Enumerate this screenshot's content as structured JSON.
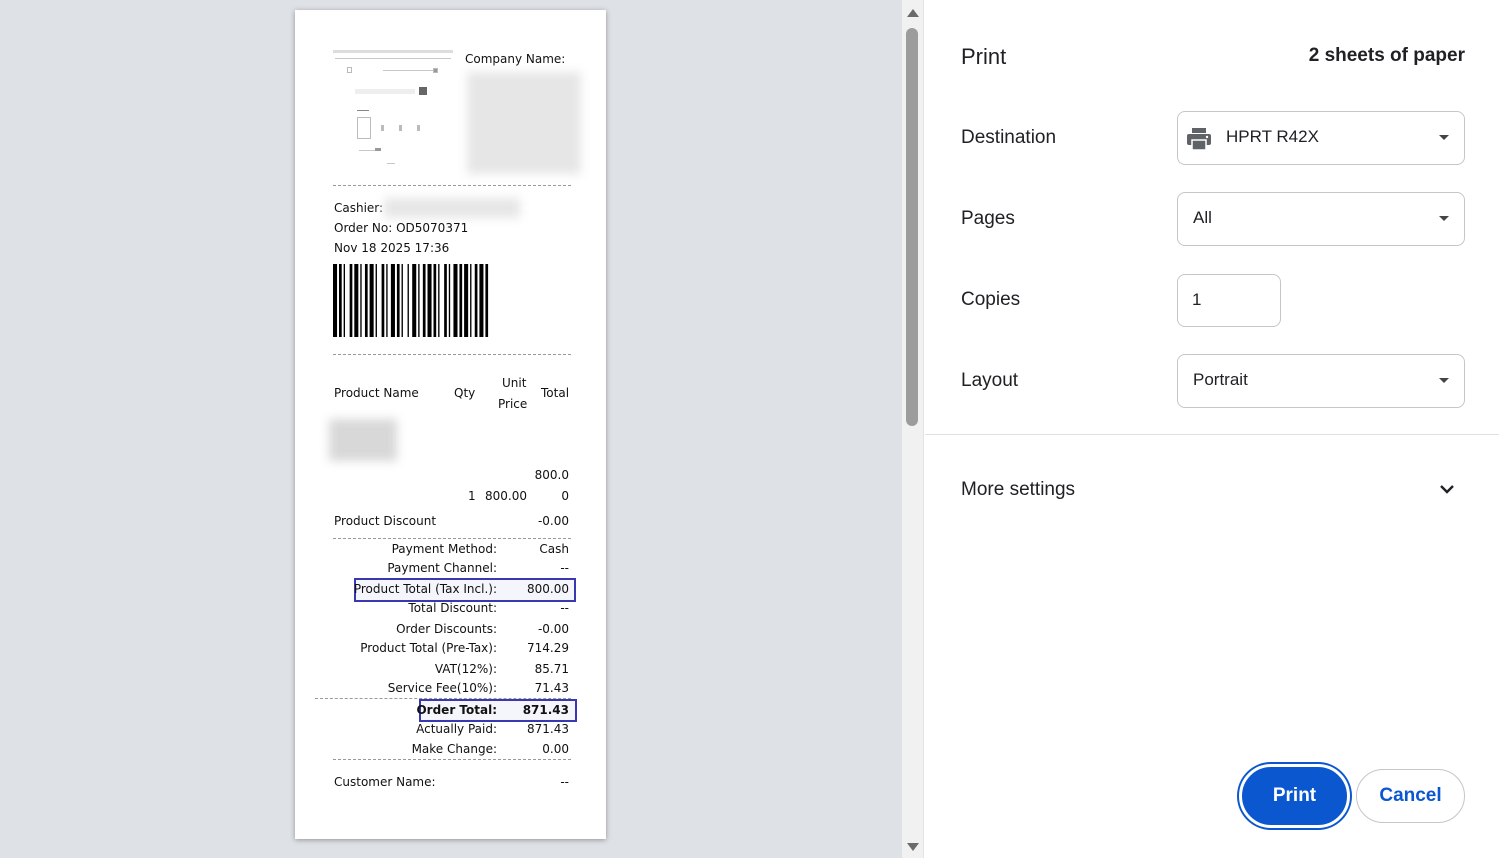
{
  "receipt": {
    "company_label": "Company Name:",
    "cashier_label": "Cashier:",
    "order_no": "Order No: OD5070371",
    "datetime": "Nov 18 2025 17:36",
    "columns": {
      "product_name": "Product Name",
      "qty": "Qty",
      "unit": "Unit",
      "price": "Price",
      "total": "Total"
    },
    "item": {
      "qty": "1",
      "unit_price": "800.00",
      "total_line1": "800.0",
      "total_line2": "0"
    },
    "product_discount": {
      "label": "Product Discount",
      "value": "-0.00"
    },
    "summary": [
      {
        "label": "Payment Method:",
        "value": "Cash"
      },
      {
        "label": "Payment Channel:",
        "value": "--"
      },
      {
        "label": "Product Total (Tax Incl.):",
        "value": "800.00"
      },
      {
        "label": "Total Discount:",
        "value": "--"
      },
      {
        "label": "Order Discounts:",
        "value": "-0.00"
      },
      {
        "label": "Product Total (Pre-Tax):",
        "value": "714.29"
      },
      {
        "label": "VAT(12%):",
        "value": "85.71"
      },
      {
        "label": "Service Fee(10%):",
        "value": "71.43"
      },
      {
        "label": "Order Total:",
        "value": "871.43"
      },
      {
        "label": "Actually Paid:",
        "value": "871.43"
      },
      {
        "label": "Make Change:",
        "value": "0.00"
      }
    ],
    "customer": {
      "label": "Customer Name:",
      "value": "--"
    }
  },
  "panel": {
    "title": "Print",
    "sheets": "2 sheets of paper",
    "destination": {
      "label": "Destination",
      "value": "HPRT R42X",
      "icon": "printer-icon"
    },
    "pages": {
      "label": "Pages",
      "value": "All"
    },
    "copies": {
      "label": "Copies",
      "value": "1"
    },
    "layout": {
      "label": "Layout",
      "value": "Portrait"
    },
    "more_settings": "More settings",
    "print_button": "Print",
    "cancel_button": "Cancel"
  },
  "colors": {
    "accent": "#0b57d0",
    "highlight_border": "#3838b0",
    "preview_bg": "#dee1e6"
  }
}
